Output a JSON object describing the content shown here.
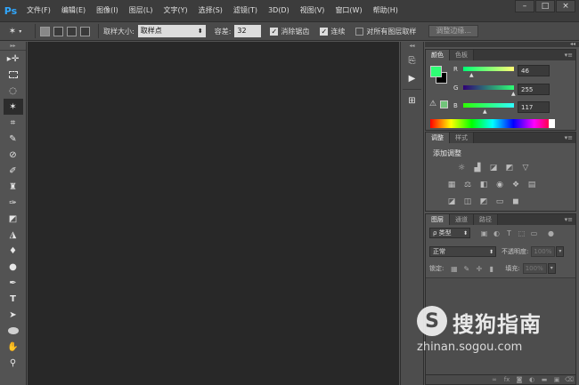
{
  "app": {
    "logo": "Ps"
  },
  "menu": [
    "文件(F)",
    "编辑(E)",
    "图像(I)",
    "图层(L)",
    "文字(Y)",
    "选择(S)",
    "滤镜(T)",
    "3D(D)",
    "视图(V)",
    "窗口(W)",
    "帮助(H)"
  ],
  "window_controls": {
    "minimize": "–",
    "restore": "□",
    "close": "×"
  },
  "options": {
    "sample_size_label": "取样大小:",
    "sample_size_value": "取样点",
    "tolerance_label": "容差:",
    "tolerance_value": "32",
    "antialias_label": "消除锯齿",
    "antialias_checked": true,
    "contiguous_label": "连续",
    "contiguous_checked": true,
    "all_layers_label": "对所有图层取样",
    "all_layers_checked": false,
    "refine_edge_label": "调整边缘..."
  },
  "tools": [
    "move-icon",
    "marquee-icon",
    "lasso-icon",
    "magic-wand-icon",
    "crop-icon",
    "eyedropper-icon",
    "healing-brush-icon",
    "brush-icon",
    "clone-stamp-icon",
    "history-brush-icon",
    "eraser-icon",
    "paint-bucket-icon",
    "blur-icon",
    "dodge-icon",
    "pen-icon",
    "type-icon",
    "path-selection-icon",
    "ellipse-icon",
    "hand-icon",
    "zoom-icon"
  ],
  "color_panel": {
    "tabs": [
      "颜色",
      "色板"
    ],
    "foreground": "#2eff75",
    "background": "#000000",
    "channels": [
      {
        "label": "R",
        "value": "46"
      },
      {
        "label": "G",
        "value": "255"
      },
      {
        "label": "B",
        "value": "117"
      }
    ]
  },
  "adjustments_panel": {
    "tabs": [
      "调整",
      "样式"
    ],
    "title": "添加调整"
  },
  "layers_panel": {
    "tabs": [
      "图层",
      "通道",
      "路径"
    ],
    "filter": "ρ 类型",
    "blend_mode": "正常",
    "opacity_label": "不透明度:",
    "opacity_value": "100%",
    "lock_label": "锁定:",
    "fill_label": "填充:",
    "fill_value": "100%"
  },
  "watermark": {
    "brand": "搜狗指南",
    "logo_letter": "S",
    "url": "zhinan.sogou.com"
  }
}
